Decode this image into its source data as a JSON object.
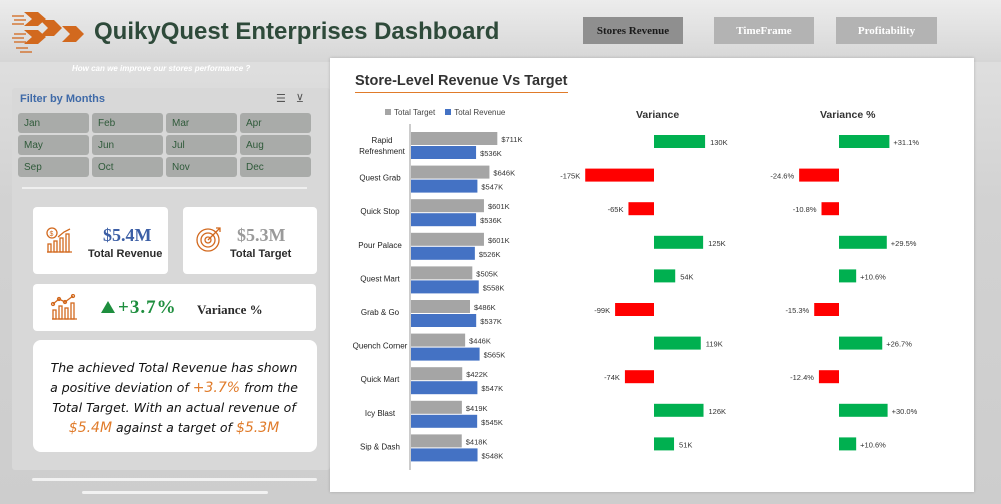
{
  "header": {
    "title": "QuikyQuest Enterprises Dashboard",
    "subtitle": "How can we improve our stores performance ?",
    "nav": [
      {
        "label": "Stores Revenue",
        "active": true
      },
      {
        "label": "TimeFrame",
        "active": false
      },
      {
        "label": "Profitability",
        "active": false
      }
    ],
    "logo_icon": "arrows-logo-icon",
    "logo_color": "#d2691e"
  },
  "filter": {
    "title": "Filter by Months",
    "months": [
      "Jan",
      "Feb",
      "Mar",
      "Apr",
      "May",
      "Jun",
      "Jul",
      "Aug",
      "Sep",
      "Oct",
      "Nov",
      "Dec"
    ],
    "icons": [
      "multi-select-icon",
      "clear-filter-icon"
    ]
  },
  "kpis": {
    "revenue": {
      "value": "$5.4M",
      "label": "Total Revenue",
      "icon": "revenue-chart-icon"
    },
    "target": {
      "value": "$5.3M",
      "label": "Total Target",
      "icon": "target-icon"
    },
    "variance": {
      "value": "+3.7%",
      "label": "Variance %",
      "icon": "variance-chart-icon"
    }
  },
  "summary": {
    "part1": "The achieved Total Revenue has shown a positive deviation of ",
    "var": "+3.7%",
    "part2": " from the Total Target. With an actual revenue of ",
    "rev": "$5.4M",
    "part3": " against a target of ",
    "tgt": "$5.3M"
  },
  "colors": {
    "target": "#a5a5a5",
    "revenue": "#4472c4",
    "positive": "#00b050",
    "negative": "#ff0000",
    "accent": "#e07b2a",
    "title": "#2e4a3a"
  },
  "chart_data": {
    "type": "bar",
    "title": "Store-Level Revenue Vs Target",
    "series_names": [
      "Total Target",
      "Total Revenue"
    ],
    "variance_title": "Variance",
    "variance_pct_title": "Variance %",
    "stores": [
      {
        "name": "Rapid Refreshment",
        "target": 711,
        "revenue": 536,
        "target_label": "$711K",
        "revenue_label": "$536K",
        "variance": 130,
        "variance_label": "130K",
        "variance_pct": 31.1,
        "variance_pct_label": "+31.1%"
      },
      {
        "name": "Quest Grab",
        "target": 646,
        "revenue": 547,
        "target_label": "$646K",
        "revenue_label": "$547K",
        "variance": -175,
        "variance_label": "-175K",
        "variance_pct": -24.6,
        "variance_pct_label": "-24.6%"
      },
      {
        "name": "Quick Stop",
        "target": 601,
        "revenue": 536,
        "target_label": "$601K",
        "revenue_label": "$536K",
        "variance": -65,
        "variance_label": "-65K",
        "variance_pct": -10.8,
        "variance_pct_label": "-10.8%"
      },
      {
        "name": "Pour Palace",
        "target": 601,
        "revenue": 526,
        "target_label": "$601K",
        "revenue_label": "$526K",
        "variance": 125,
        "variance_label": "125K",
        "variance_pct": 29.5,
        "variance_pct_label": "+29.5%"
      },
      {
        "name": "Quest Mart",
        "target": 505,
        "revenue": 558,
        "target_label": "$505K",
        "revenue_label": "$558K",
        "variance": 54,
        "variance_label": "54K",
        "variance_pct": 10.6,
        "variance_pct_label": "+10.6%"
      },
      {
        "name": "Grab & Go",
        "target": 486,
        "revenue": 537,
        "target_label": "$486K",
        "revenue_label": "$537K",
        "variance": -99,
        "variance_label": "-99K",
        "variance_pct": -15.3,
        "variance_pct_label": "-15.3%"
      },
      {
        "name": "Quench Corner",
        "target": 446,
        "revenue": 565,
        "target_label": "$446K",
        "revenue_label": "$565K",
        "variance": 119,
        "variance_label": "119K",
        "variance_pct": 26.7,
        "variance_pct_label": "+26.7%"
      },
      {
        "name": "Quick Mart",
        "target": 422,
        "revenue": 547,
        "target_label": "$422K",
        "revenue_label": "$547K",
        "variance": -74,
        "variance_label": "-74K",
        "variance_pct": -12.4,
        "variance_pct_label": "-12.4%"
      },
      {
        "name": "Icy Blast",
        "target": 419,
        "revenue": 545,
        "target_label": "$419K",
        "revenue_label": "$545K",
        "variance": 126,
        "variance_label": "126K",
        "variance_pct": 30.0,
        "variance_pct_label": "+30.0%"
      },
      {
        "name": "Sip & Dash",
        "target": 418,
        "revenue": 548,
        "target_label": "$418K",
        "revenue_label": "$548K",
        "variance": 51,
        "variance_label": "51K",
        "variance_pct": 10.6,
        "variance_pct_label": "+10.6%"
      }
    ]
  }
}
